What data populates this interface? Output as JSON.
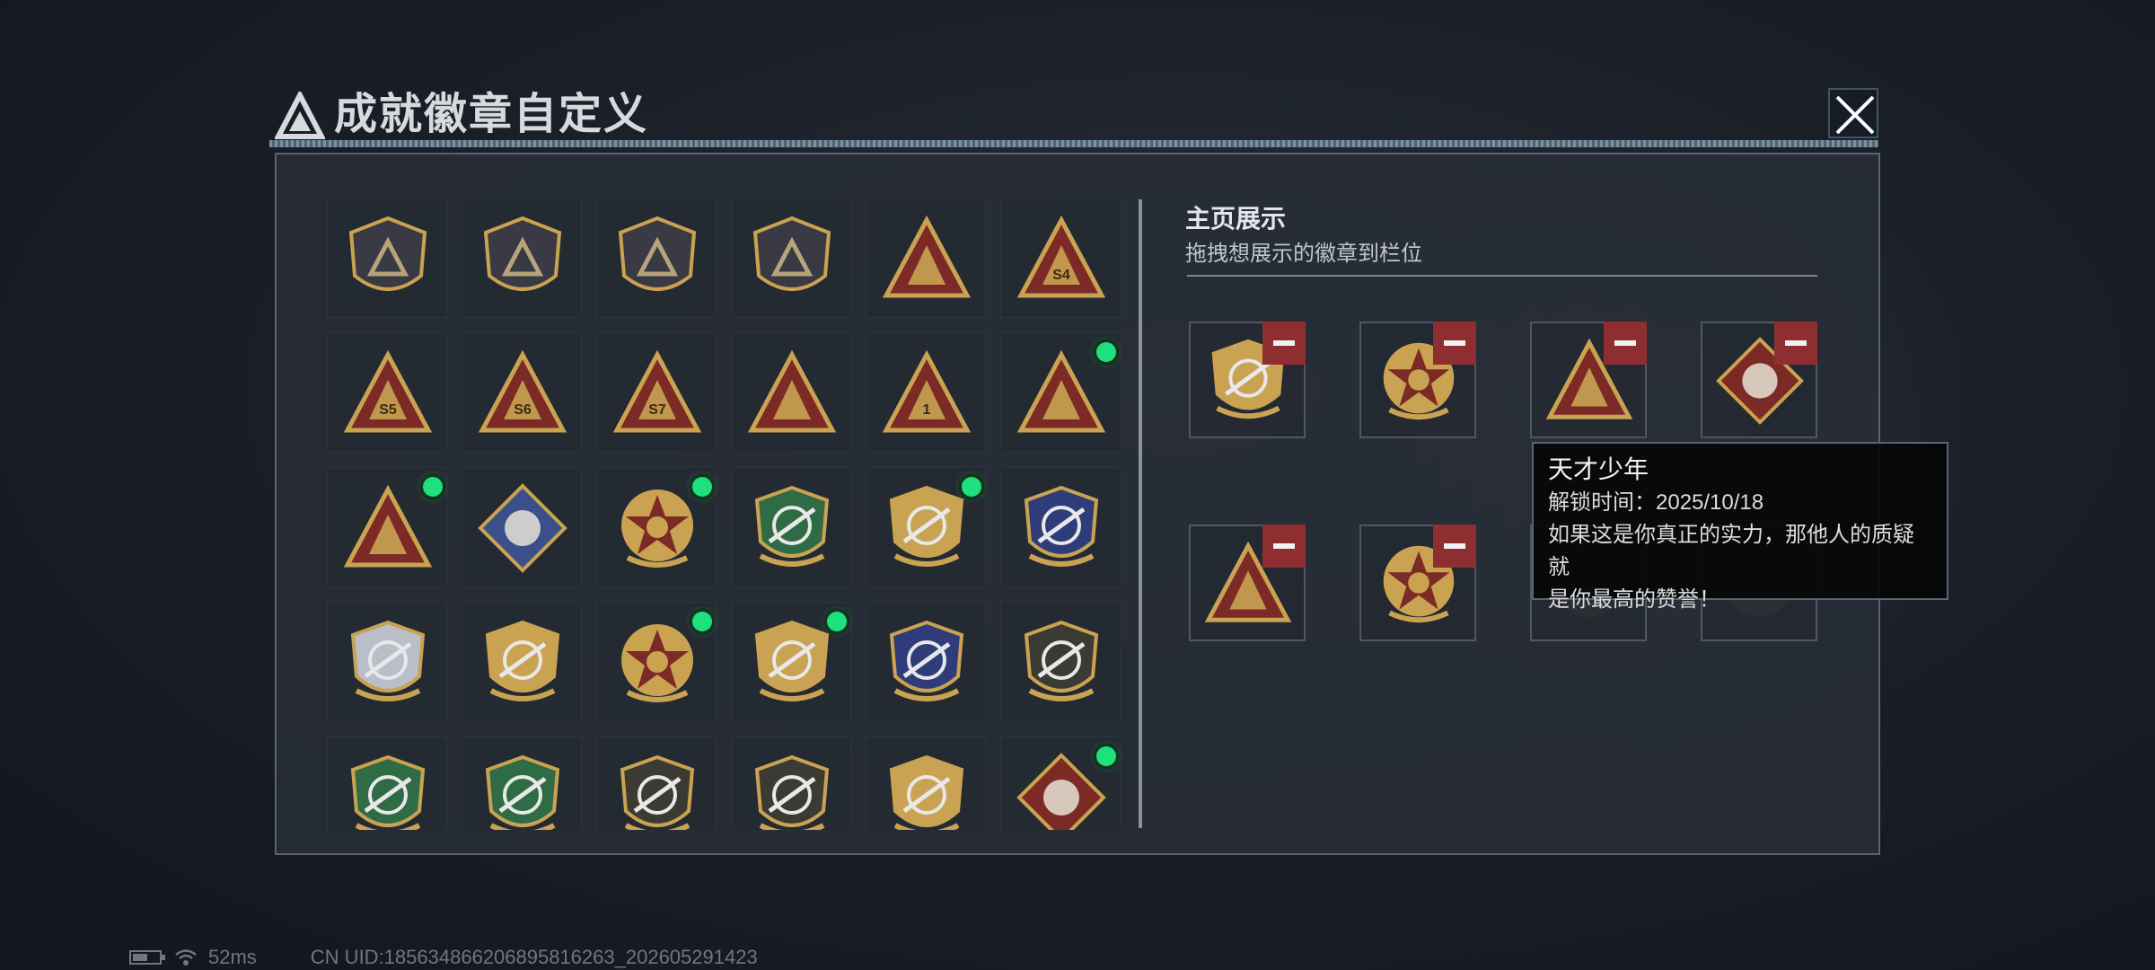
{
  "title": "成就徽章自定义",
  "showcase": {
    "title": "主页展示",
    "subtitle": "拖拽想展示的徽章到栏位"
  },
  "tooltip": {
    "name": "天才少年",
    "unlock_time": "解锁时间：2025/10/18",
    "description_line1": "如果这是你真正的实力，那他人的质疑就",
    "description_line2": "是你最高的赞誉！"
  },
  "status": {
    "ping": "52ms",
    "uid": "CN UID:18563486620689581626​3_202605291423"
  },
  "badges": [
    {
      "icon": "shield-triangle-logo-badge",
      "new": false
    },
    {
      "icon": "shield-helicopter-badge",
      "new": false
    },
    {
      "icon": "shield-diamond-emblem-badge",
      "new": false
    },
    {
      "icon": "shield-dagger-badge",
      "new": false
    },
    {
      "icon": "triangle-satellite-badge",
      "new": false
    },
    {
      "icon": "triangle-s4-badge",
      "label": "S4",
      "new": false
    },
    {
      "icon": "triangle-s5-backpack-badge",
      "label": "S5",
      "new": false
    },
    {
      "icon": "triangle-s6-badge",
      "label": "S6",
      "new": false
    },
    {
      "icon": "triangle-s7-badge",
      "label": "S7",
      "new": false
    },
    {
      "icon": "triangle-bird-badge",
      "new": false
    },
    {
      "icon": "triangle-number-one-badge",
      "label": "1",
      "new": false
    },
    {
      "icon": "triangle-usb-badge",
      "new": true
    },
    {
      "icon": "triangle-soldiers-badge",
      "new": true
    },
    {
      "icon": "diamond-rocket-launcher-badge",
      "new": false
    },
    {
      "icon": "star-burst-tank-badge",
      "new": true
    },
    {
      "icon": "green-shield-badge",
      "new": false
    },
    {
      "icon": "gold-shield-emblem-badge",
      "new": true
    },
    {
      "icon": "blue-shield-diamond-badge",
      "new": false
    },
    {
      "icon": "silver-crosshair-badge",
      "new": false
    },
    {
      "icon": "gold-tank-badge",
      "new": false
    },
    {
      "icon": "star-burst-badge",
      "new": true
    },
    {
      "icon": "gold-rifle-crossed-badge",
      "new": true
    },
    {
      "icon": "blue-crosshair-rifle-badge",
      "new": false
    },
    {
      "icon": "dark-rifle-badge",
      "new": false
    },
    {
      "icon": "green-crosshair-rifle-badge",
      "new": false
    },
    {
      "icon": "green-crosshair-badge",
      "new": false
    },
    {
      "icon": "dark-sniper-badge",
      "new": false
    },
    {
      "icon": "dark-pistol-badge",
      "new": false
    },
    {
      "icon": "gold-crosshair-badge",
      "new": false
    },
    {
      "icon": "wolf-diamond-badge",
      "new": true
    }
  ],
  "showcase_slots": [
    {
      "icon": "gold-shield-emblem-badge",
      "removable": true
    },
    {
      "icon": "star-burst-tank-badge",
      "removable": true
    },
    {
      "icon": "triangle-usb-badge",
      "removable": true
    },
    {
      "icon": "wolf-diamond-badge",
      "removable": true
    },
    {
      "icon": "triangle-soldiers-badge",
      "removable": true
    },
    {
      "icon": "star-burst-badge",
      "removable": true
    },
    {
      "icon": "hidden-badge",
      "removable": false
    },
    {
      "icon": "hidden-badge",
      "removable": false
    }
  ],
  "colors": {
    "gold": "#c9a252",
    "dark_red": "#7c2a25",
    "remove_red": "#8e2e30",
    "new_green": "#1ee07c",
    "navy": "#2e3d7a"
  }
}
